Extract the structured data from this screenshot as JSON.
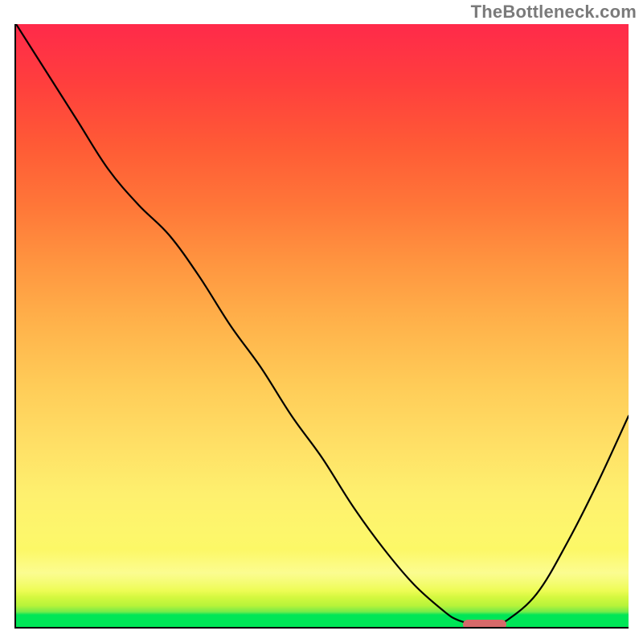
{
  "watermark": "TheBottleneck.com",
  "chart_data": {
    "type": "line",
    "title": "",
    "xlabel": "",
    "ylabel": "",
    "x": [
      0.0,
      0.05,
      0.1,
      0.15,
      0.2,
      0.25,
      0.3,
      0.35,
      0.4,
      0.45,
      0.5,
      0.55,
      0.6,
      0.65,
      0.7,
      0.72,
      0.74,
      0.76,
      0.78,
      0.8,
      0.85,
      0.9,
      0.95,
      1.0
    ],
    "values": [
      1.0,
      0.92,
      0.84,
      0.76,
      0.7,
      0.65,
      0.58,
      0.5,
      0.43,
      0.35,
      0.28,
      0.2,
      0.13,
      0.07,
      0.025,
      0.012,
      0.006,
      0.004,
      0.004,
      0.01,
      0.055,
      0.14,
      0.24,
      0.35
    ],
    "xlim": [
      0,
      1
    ],
    "ylim": [
      0,
      1
    ],
    "marker": {
      "x_start": 0.73,
      "x_end": 0.8,
      "y": 0.004
    },
    "gradient_stops": [
      {
        "pos": 0.0,
        "color": "#00e657"
      },
      {
        "pos": 0.06,
        "color": "#eafc43"
      },
      {
        "pos": 0.22,
        "color": "#fef06e"
      },
      {
        "pos": 0.5,
        "color": "#ffb34b"
      },
      {
        "pos": 0.8,
        "color": "#ff5a36"
      },
      {
        "pos": 1.0,
        "color": "#ff2a4a"
      }
    ]
  }
}
